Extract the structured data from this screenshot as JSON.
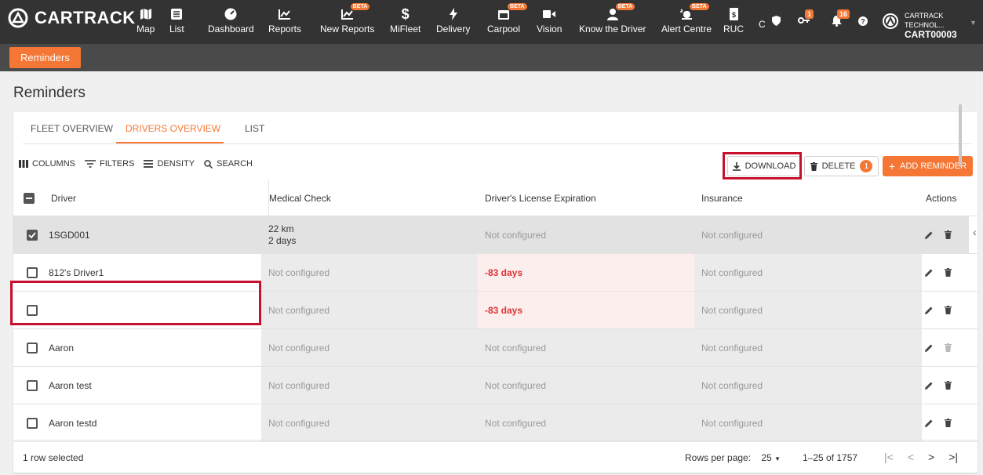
{
  "app": {
    "brand": "CARTRACK"
  },
  "nav": [
    {
      "label": "Map",
      "icon": "map-icon"
    },
    {
      "label": "List",
      "icon": "list-icon"
    },
    {
      "label": "Dashboard",
      "icon": "dashboard-icon"
    },
    {
      "label": "Reports",
      "icon": "chart-icon"
    },
    {
      "label": "New Reports",
      "icon": "chart-icon",
      "beta": "BETA"
    },
    {
      "label": "MiFleet",
      "icon": "dollar-icon"
    },
    {
      "label": "Delivery",
      "icon": "bolt-icon"
    },
    {
      "label": "Carpool",
      "icon": "calendar-icon",
      "beta": "BETA"
    },
    {
      "label": "Vision",
      "icon": "video-icon"
    },
    {
      "label": "Know the Driver",
      "icon": "person-icon",
      "beta": "BETA"
    },
    {
      "label": "Alert Centre",
      "icon": "alert-icon",
      "beta": "BETA"
    },
    {
      "label": "RUC",
      "icon": "ruc-icon"
    }
  ],
  "topright": {
    "c_label": "C",
    "badge_keys": "1",
    "badge_notifications": "16",
    "account_name": "CARTRACK TECHNOL...",
    "account_code": "CART00003"
  },
  "subnav": {
    "active_tab": "Reminders"
  },
  "page": {
    "title": "Reminders"
  },
  "tabs": [
    "FLEET OVERVIEW",
    "DRIVERS OVERVIEW",
    "LIST"
  ],
  "toolbar": {
    "columns": "COLUMNS",
    "filters": "FILTERS",
    "density": "DENSITY",
    "search": "SEARCH",
    "download": "DOWNLOAD",
    "delete": "DELETE",
    "delete_count": "1",
    "add": "ADD REMINDER"
  },
  "columns": {
    "driver": "Driver",
    "medical": "Medical Check",
    "license": "Driver's License Expiration",
    "insurance": "Insurance",
    "actions": "Actions"
  },
  "rows": [
    {
      "driver": "1SGD001",
      "medical_1": "22 km",
      "medical_2": "2 days",
      "license": "Not configured",
      "insurance": "Not configured"
    },
    {
      "driver": "812's Driver1",
      "medical": "Not configured",
      "license": "-83 days",
      "insurance": "Not configured"
    },
    {
      "driver": "",
      "medical": "Not configured",
      "license": "-83 days",
      "insurance": "Not configured"
    },
    {
      "driver": "Aaron",
      "medical": "Not configured",
      "license": "Not configured",
      "insurance": "Not configured"
    },
    {
      "driver": "Aaron test",
      "medical": "Not configured",
      "license": "Not configured",
      "insurance": "Not configured"
    },
    {
      "driver": "Aaron testd",
      "medical": "Not configured",
      "license": "Not configured",
      "insurance": "Not configured"
    }
  ],
  "footer": {
    "selected": "1 row selected",
    "rows_per_page_label": "Rows per page:",
    "rows_per_page_value": "25",
    "range": "1–25 of 1757"
  },
  "colors": {
    "accent": "#f47735",
    "topbar": "#333333",
    "highlight": "#c8102e",
    "negative": "#dd3333"
  }
}
